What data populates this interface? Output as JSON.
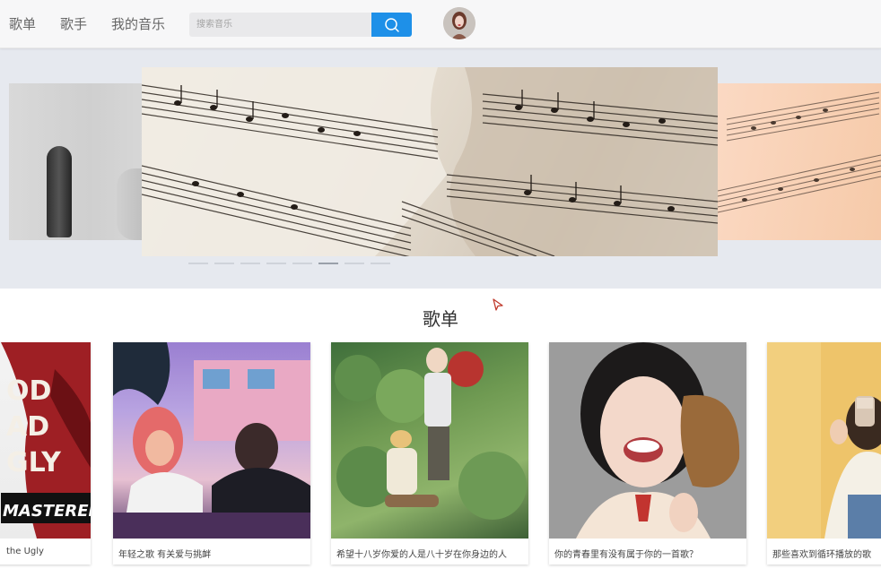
{
  "nav": {
    "items": [
      {
        "label": "歌单"
      },
      {
        "label": "歌手"
      },
      {
        "label": "我的音乐"
      }
    ],
    "search_placeholder": "搜索音乐"
  },
  "carousel": {
    "slide_count": 8,
    "active_index": 5
  },
  "section": {
    "title": "歌单"
  },
  "playlists": [
    {
      "title": "the Ugly",
      "cover_text": [
        "OD",
        "AD",
        "GLY",
        "MASTERED"
      ]
    },
    {
      "title": "年轻之歌 有关爱与挑衅"
    },
    {
      "title": "希望十八岁你爱的人是八十岁在你身边的人"
    },
    {
      "title": "你的青春里有没有属于你的一首歌？"
    },
    {
      "title": "那些喜欢到循环播放的歌"
    }
  ],
  "colors": {
    "accent": "#1e90e8",
    "nav_bg": "#f7f7f8",
    "carousel_bg": "#e6e9ef"
  }
}
